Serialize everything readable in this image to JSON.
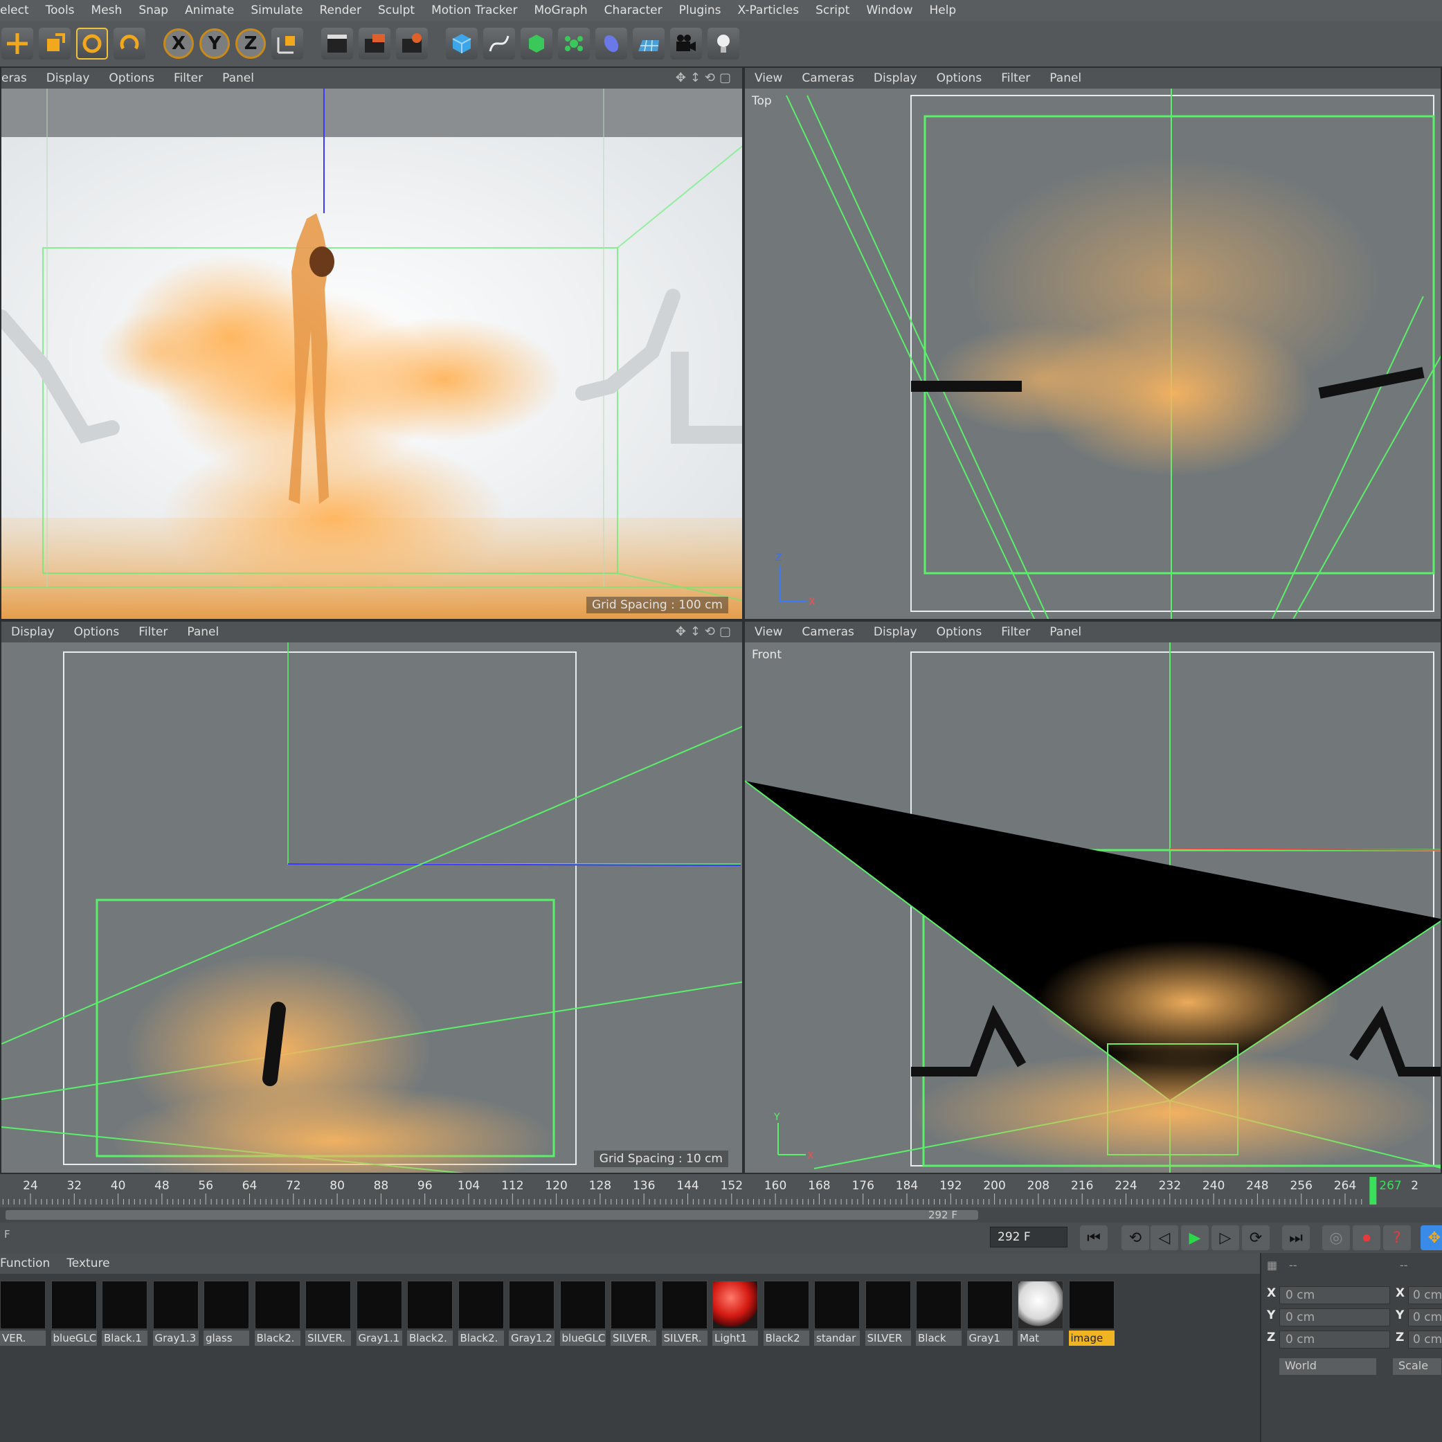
{
  "menu": [
    "elect",
    "Tools",
    "Mesh",
    "Snap",
    "Animate",
    "Simulate",
    "Render",
    "Sculpt",
    "Motion Tracker",
    "MoGraph",
    "Character",
    "Plugins",
    "X-Particles",
    "Script",
    "Window",
    "Help"
  ],
  "toolbar": {
    "axis_x": "X",
    "axis_y": "Y",
    "axis_z": "Z",
    "icons": [
      "move-icon",
      "scale-icon",
      "rotate-icon",
      "recent-tool-icon",
      "axis-x-lock",
      "axis-y-lock",
      "axis-z-lock",
      "coordinate-system-icon",
      "render-view-icon",
      "render-picture-viewer-icon",
      "render-settings-icon",
      "cube-primitive-icon",
      "spline-pen-icon",
      "subdivision-surface-icon",
      "mograph-cloner-icon",
      "deformer-icon",
      "floor-icon",
      "camera-icon",
      "light-bulb-icon"
    ]
  },
  "viewports": {
    "perspective": {
      "menu": [
        "eras",
        "Display",
        "Options",
        "Filter",
        "Panel"
      ],
      "grid_label": "Grid Spacing : 100 cm"
    },
    "top": {
      "menu": [
        "View",
        "Cameras",
        "Display",
        "Options",
        "Filter",
        "Panel"
      ],
      "label": "Top"
    },
    "right": {
      "menu": [
        "Display",
        "Options",
        "Filter",
        "Panel"
      ],
      "grid_label": "Grid Spacing : 10 cm"
    },
    "front": {
      "menu": [
        "View",
        "Cameras",
        "Display",
        "Options",
        "Filter",
        "Panel"
      ],
      "label": "Front"
    }
  },
  "axis_gizmo": {
    "x": "X",
    "y": "Y",
    "z": "Z"
  },
  "timeline": {
    "ticks": [
      "24",
      "32",
      "40",
      "48",
      "56",
      "64",
      "72",
      "80",
      "88",
      "96",
      "104",
      "112",
      "120",
      "128",
      "136",
      "144",
      "152",
      "160",
      "168",
      "176",
      "184",
      "192",
      "200",
      "208",
      "216",
      "224",
      "232",
      "240",
      "248",
      "256",
      "264"
    ],
    "current_frame": "267",
    "tail": "2",
    "end_frame_scrub": "292 F",
    "start_label": "F",
    "end_frame_field": "292 F"
  },
  "materials": {
    "menu": [
      "Function",
      "Texture"
    ],
    "items": [
      "VER.",
      "blueGLC",
      "Black.1",
      "Gray1.3",
      "glass",
      "Black2.",
      "SILVER.",
      "Gray1.1",
      "Black2.",
      "Black2.",
      "Gray1.2",
      "blueGLC",
      "SILVER.",
      "SILVER.",
      "Light1",
      "Black2",
      "standar",
      "SILVER",
      "Black",
      "Gray1",
      "Mat",
      "image"
    ],
    "selected": "image"
  },
  "coordinates": {
    "rows": [
      {
        "axis": "X",
        "value": "0 cm",
        "axis2": "X",
        "value2": "0 cm"
      },
      {
        "axis": "Y",
        "value": "0 cm",
        "axis2": "Y",
        "value2": "0 cm"
      },
      {
        "axis": "Z",
        "value": "0 cm",
        "axis2": "Z",
        "value2": "0 cm"
      }
    ],
    "mode": "World",
    "apply": "Scale",
    "header_dash": "--"
  }
}
